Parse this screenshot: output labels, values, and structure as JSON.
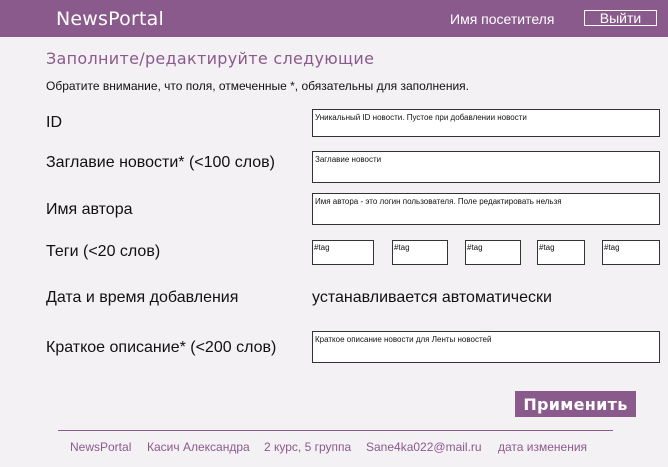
{
  "header": {
    "brand": "NewsPortal",
    "user_name": "Имя посетителя",
    "logout_label": "Выйти"
  },
  "form": {
    "title": "Заполните/редактируйте следующие",
    "note": "Обратите внимание, что поля, отмеченные *, обязательны для заполнения.",
    "id_label": "ID",
    "id_placeholder": "Уникальный ID новости. Пустое при добавлении новости",
    "headline_label": "Заглавие новости* (<100 слов)",
    "headline_placeholder": "Заглавие новости",
    "author_label": "Имя автора",
    "author_placeholder": "Имя автора - это логин пользователя. Поле редактировать нельзя",
    "tags_label": "Теги (<20 слов)",
    "tag_placeholders": [
      "#tag",
      "#tag",
      "#tag",
      "#tag",
      "#tag"
    ],
    "datetime_label": "Дата и время  добавления",
    "datetime_value": "устанавливается автоматически",
    "summary_label": "Краткое описание* (<200 слов)",
    "summary_placeholder": "Краткое описание новости для Ленты новостей",
    "apply_label": "Применить"
  },
  "footer": {
    "items": [
      "NewsPortal",
      "Касич Александра",
      "2 курс, 5 группа",
      "Sane4ka022@mail.ru",
      "дата изменения"
    ]
  },
  "colors": {
    "accent": "#8a5a8c",
    "background": "#f4f1f4"
  }
}
